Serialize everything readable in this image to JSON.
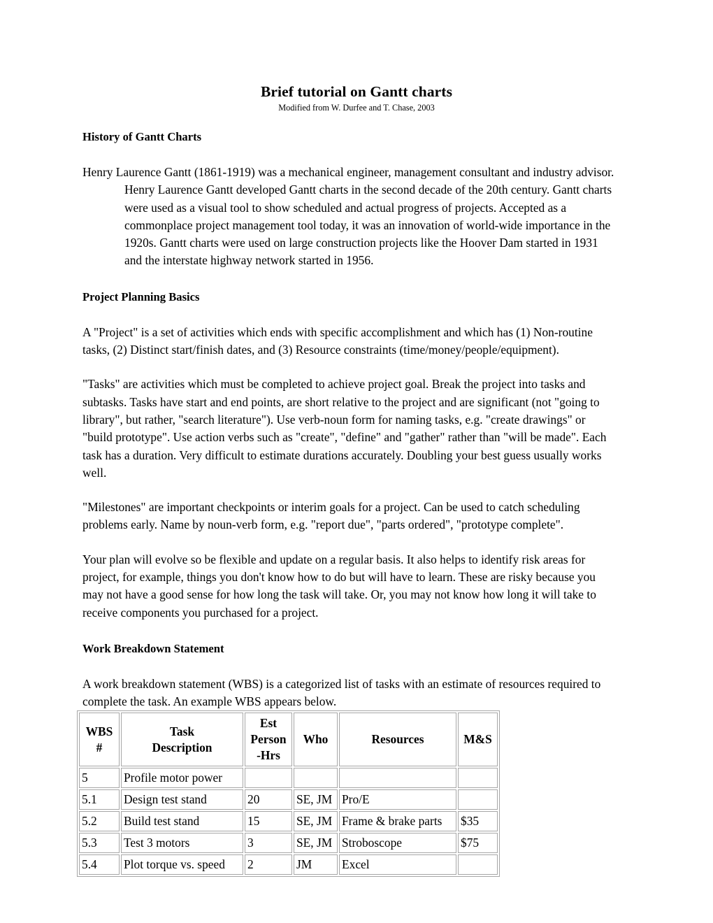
{
  "document": {
    "title": "Brief tutorial on Gantt charts",
    "subtitle": "Modified from W. Durfee and T. Chase, 2003"
  },
  "sections": {
    "history": {
      "heading": "History of Gantt Charts",
      "paragraph": "Henry Laurence Gantt (1861-1919) was a mechanical engineer, management consultant and industry advisor. Henry Laurence Gantt developed Gantt charts in the second decade of the 20th century. Gantt charts were used as a visual tool to show scheduled and actual progress of projects. Accepted as a commonplace project management tool today, it was an innovation of world-wide importance in the 1920s.  Gantt charts were used on large construction projects like the Hoover Dam started in 1931 and the interstate highway network started in 1956."
    },
    "planning": {
      "heading": "Project Planning Basics",
      "paragraph_project": "A \"Project\" is a set of activities which ends with specific accomplishment and which has (1) Non-routine tasks, (2) Distinct start/finish dates, and (3) Resource constraints (time/money/people/equipment).",
      "paragraph_tasks": "\"Tasks\" are activities which must be completed to achieve project goal. Break the project into tasks and subtasks. Tasks have start and end points, are short relative to the project and are significant (not \"going to library\", but rather, \"search literature\"). Use verb-noun form for naming tasks, e.g. \"create drawings\" or \"build prototype\". Use action verbs such as \"create\", \"define\" and \"gather\" rather than \"will be made\". Each task has a duration. Very difficult to estimate durations accurately. Doubling your best guess usually works well.",
      "paragraph_milestones": "\"Milestones\" are important checkpoints or interim goals for a project. Can be used to catch scheduling problems early. Name by noun-verb form, e.g. \"report due\", \"parts ordered\", \"prototype complete\".",
      "paragraph_plan": "Your plan will evolve so be flexible and update on a regular basis. It also helps to identify risk areas for project, for example, things you don't know how to do but will have to learn. These are risky because you may not have a good sense for how long the task will take. Or, you may not know how long it will take to receive components you purchased for a project."
    },
    "wbs": {
      "heading": "Work Breakdown Statement",
      "paragraph": "A work breakdown statement (WBS) is a categorized list of tasks with an estimate of resources required to complete the task. An example WBS appears below."
    }
  },
  "wbs_table": {
    "headers": [
      "WBS #",
      "Task Description",
      "Est Person -Hrs",
      "Who",
      "Resources",
      "M&S"
    ],
    "header_lines": {
      "wbs": [
        "WBS",
        "#"
      ],
      "task": [
        "Task",
        "Description"
      ],
      "hrs": [
        "Est",
        "Person",
        "-Hrs"
      ],
      "who": [
        "Who"
      ],
      "resources": [
        "Resources"
      ],
      "ms": [
        "M&S"
      ]
    },
    "rows": [
      {
        "wbs": "5",
        "task": "Profile motor power",
        "hrs": "",
        "who": "",
        "resources": "",
        "ms": ""
      },
      {
        "wbs": "5.1",
        "task": "Design test stand",
        "hrs": "20",
        "who": "SE, JM",
        "resources": "Pro/E",
        "ms": ""
      },
      {
        "wbs": "5.2",
        "task": "Build test stand",
        "hrs": "15",
        "who": "SE, JM",
        "resources": "Frame & brake parts",
        "ms": "$35"
      },
      {
        "wbs": "5.3",
        "task": "Test 3 motors",
        "hrs": "3",
        "who": "SE, JM",
        "resources": "Stroboscope",
        "ms": "$75"
      },
      {
        "wbs": "5.4",
        "task": "Plot torque vs. speed",
        "hrs": "2",
        "who": "JM",
        "resources": "Excel",
        "ms": ""
      }
    ]
  },
  "colors": {
    "text": "#000000",
    "page_background": "#ffffff",
    "table_border": "#a6a6a6"
  }
}
